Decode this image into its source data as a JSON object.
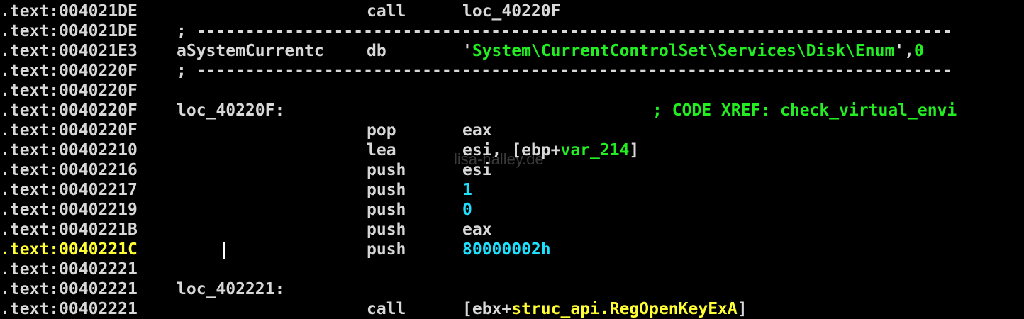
{
  "watermark": "lisa-halley.de",
  "lines": [
    {
      "addr": ".text:004021DE",
      "label": "",
      "mnemonic": "call",
      "operand": [
        {
          "t": "loc_40220F",
          "c": "w"
        }
      ]
    },
    {
      "addr": ".text:004021DE",
      "separator": "; -----------------------------------------------------------------------------"
    },
    {
      "addr": ".text:004021E3",
      "label": "aSystemCurrentc",
      "mnemonic": "db",
      "operand": [
        {
          "t": "'",
          "c": "w"
        },
        {
          "t": "System\\CurrentControlSet\\Services\\Disk\\Enum",
          "c": "g"
        },
        {
          "t": "',",
          "c": "w"
        },
        {
          "t": "0",
          "c": "g"
        }
      ]
    },
    {
      "addr": ".text:0040220F",
      "separator": "; -----------------------------------------------------------------------------"
    },
    {
      "addr": ".text:0040220F"
    },
    {
      "addr": ".text:0040220F",
      "label": "loc_40220F:",
      "comment": "; CODE XREF: check_virtual_envi"
    },
    {
      "addr": ".text:0040220F",
      "mnemonic": "pop",
      "operand": [
        {
          "t": "eax",
          "c": "w"
        }
      ]
    },
    {
      "addr": ".text:00402210",
      "mnemonic": "lea",
      "operand": [
        {
          "t": "esi, [ebp+",
          "c": "w"
        },
        {
          "t": "var_214",
          "c": "g"
        },
        {
          "t": "]",
          "c": "w"
        }
      ]
    },
    {
      "addr": ".text:00402216",
      "mnemonic": "push",
      "operand": [
        {
          "t": "esi",
          "c": "w"
        }
      ]
    },
    {
      "addr": ".text:00402217",
      "mnemonic": "push",
      "operand": [
        {
          "t": "1",
          "c": "c"
        }
      ]
    },
    {
      "addr": ".text:00402219",
      "mnemonic": "push",
      "operand": [
        {
          "t": "0",
          "c": "c"
        }
      ]
    },
    {
      "addr": ".text:0040221B",
      "mnemonic": "push",
      "operand": [
        {
          "t": "eax",
          "c": "w"
        }
      ]
    },
    {
      "addr": ".text:0040221C",
      "mnemonic": "push",
      "operand": [
        {
          "t": "80000002h",
          "c": "c"
        }
      ],
      "highlight": true
    },
    {
      "addr": ".text:00402221"
    },
    {
      "addr": ".text:00402221",
      "label": "loc_402221:"
    },
    {
      "addr": ".text:00402221",
      "mnemonic": "call",
      "operand": [
        {
          "t": "[ebx+",
          "c": "w"
        },
        {
          "t": "struc_api.RegOpenKeyExA",
          "c": "y"
        },
        {
          "t": "]",
          "c": "w"
        }
      ]
    }
  ]
}
